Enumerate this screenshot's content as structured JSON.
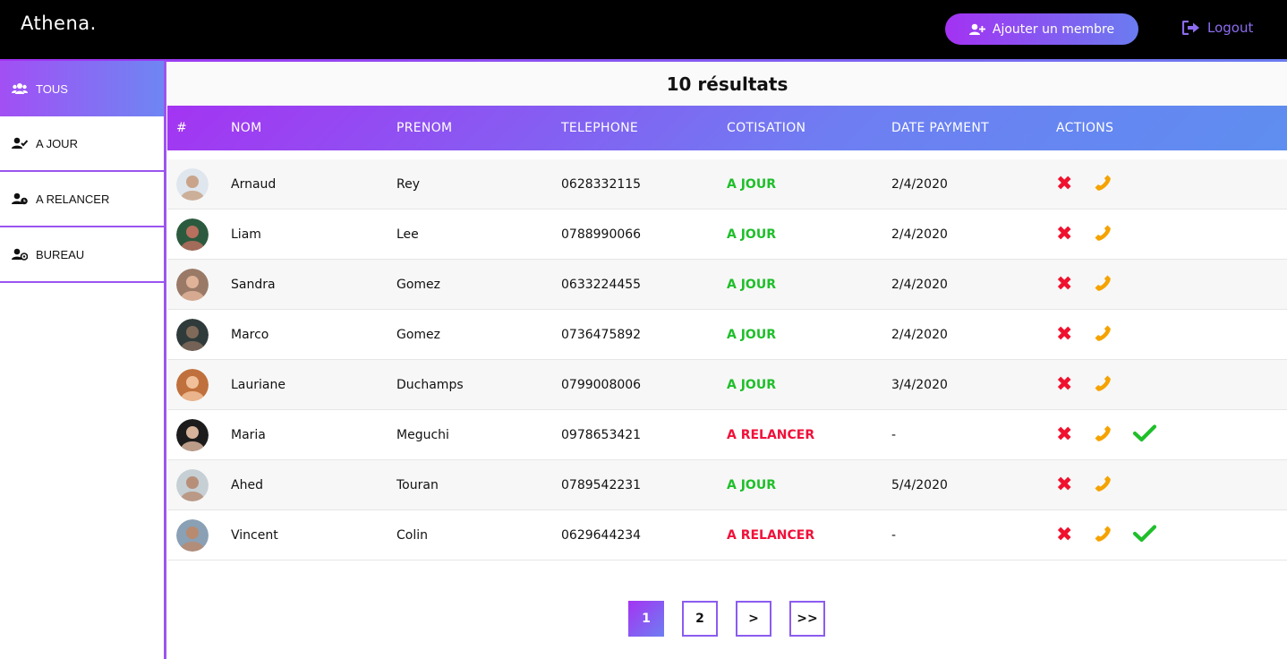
{
  "app": {
    "brand": "Athena."
  },
  "header": {
    "add_member_label": "Ajouter un membre",
    "logout_label": "Logout"
  },
  "sidebar": {
    "items": [
      {
        "label": "TOUS",
        "icon": "users-icon",
        "active": true
      },
      {
        "label": "A JOUR",
        "icon": "user-check-icon",
        "active": false
      },
      {
        "label": "A RELANCER",
        "icon": "user-clock-icon",
        "active": false
      },
      {
        "label": "BUREAU",
        "icon": "user-tie-icon",
        "active": false
      }
    ]
  },
  "main": {
    "results_label": "10 résultats",
    "columns": [
      "#",
      "NOM",
      "PRENOM",
      "TELEPHONE",
      "COTISATION",
      "DATE PAYMENT",
      "ACTIONS"
    ],
    "rows": [
      {
        "nom": "Arnaud",
        "prenom": "Rey",
        "tel": "0628332115",
        "cotisation": "A JOUR",
        "date": "2/4/2020"
      },
      {
        "nom": "Liam",
        "prenom": "Lee",
        "tel": "0788990066",
        "cotisation": "A JOUR",
        "date": "2/4/2020"
      },
      {
        "nom": "Sandra",
        "prenom": "Gomez",
        "tel": "0633224455",
        "cotisation": "A JOUR",
        "date": "2/4/2020"
      },
      {
        "nom": "Marco",
        "prenom": "Gomez",
        "tel": "0736475892",
        "cotisation": "A JOUR",
        "date": "2/4/2020"
      },
      {
        "nom": "Lauriane",
        "prenom": "Duchamps",
        "tel": "0799008006",
        "cotisation": "A JOUR",
        "date": "3/4/2020"
      },
      {
        "nom": "Maria",
        "prenom": "Meguchi",
        "tel": "0978653421",
        "cotisation": "A RELANCER",
        "date": "-"
      },
      {
        "nom": "Ahed",
        "prenom": "Touran",
        "tel": "0789542231",
        "cotisation": "A JOUR",
        "date": "5/4/2020"
      },
      {
        "nom": "Vincent",
        "prenom": "Colin",
        "tel": "0629644234",
        "cotisation": "A RELANCER",
        "date": "-"
      }
    ],
    "pagination": [
      "1",
      "2",
      ">",
      ">>"
    ],
    "current_page": "1"
  },
  "colors": {
    "accent_start": "#a332f2",
    "accent_end": "#6a7cf0",
    "status_ok": "#1fbf2a",
    "status_late": "#f0113a",
    "call": "#f5a300",
    "delete": "#f0112e"
  }
}
